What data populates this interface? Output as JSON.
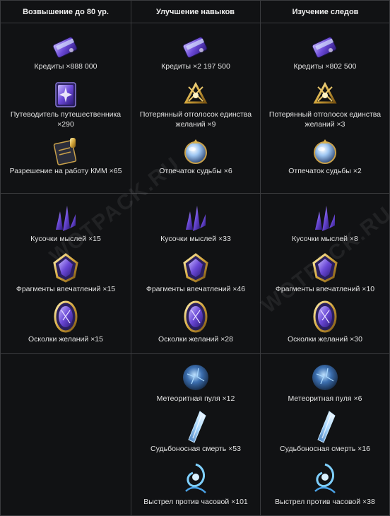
{
  "headers": [
    "Возвышение до 80 ур.",
    "Улучшение навыков",
    "Изучение следов"
  ],
  "watermark": "WOTPACK.RU",
  "row1": {
    "c1": [
      {
        "label": "Кредиты ×888 000",
        "icon": "credits-card-icon"
      },
      {
        "label": "Путеводитель путешественника ×290",
        "icon": "travelers-guide-book-icon"
      },
      {
        "label": "Разрешение на работу КММ ×65",
        "icon": "work-permit-icon"
      }
    ],
    "c2": [
      {
        "label": "Кредиты ×2 197 500",
        "icon": "credits-card-icon"
      },
      {
        "label": "Потерянный отголосок единства желаний ×9",
        "icon": "lost-echo-icon"
      },
      {
        "label": "Отпечаток судьбы ×6",
        "icon": "fate-imprint-orb-icon"
      }
    ],
    "c3": [
      {
        "label": "Кредиты ×802 500",
        "icon": "credits-card-icon"
      },
      {
        "label": "Потерянный отголосок единства желаний ×3",
        "icon": "lost-echo-icon"
      },
      {
        "label": "Отпечаток судьбы ×2",
        "icon": "fate-imprint-orb-icon"
      }
    ]
  },
  "row2": {
    "c1": [
      {
        "label": "Кусочки мыслей ×15",
        "icon": "thought-shards-icon"
      },
      {
        "label": "Фрагменты впечатлений ×15",
        "icon": "impression-fragment-icon"
      },
      {
        "label": "Осколки желаний ×15",
        "icon": "wish-shards-icon"
      }
    ],
    "c2": [
      {
        "label": "Кусочки мыслей ×33",
        "icon": "thought-shards-icon"
      },
      {
        "label": "Фрагменты впечатлений ×46",
        "icon": "impression-fragment-icon"
      },
      {
        "label": "Осколки желаний ×28",
        "icon": "wish-shards-icon"
      }
    ],
    "c3": [
      {
        "label": "Кусочки мыслей ×8",
        "icon": "thought-shards-icon"
      },
      {
        "label": "Фрагменты впечатлений ×10",
        "icon": "impression-fragment-icon"
      },
      {
        "label": "Осколки желаний ×30",
        "icon": "wish-shards-icon"
      }
    ]
  },
  "row3": {
    "c2": [
      {
        "label": "Метеоритная пуля ×12",
        "icon": "meteorite-bullet-icon"
      },
      {
        "label": "Судьбоносная смерть ×53",
        "icon": "fateful-death-icon"
      },
      {
        "label": "Выстрел против часовой ×101",
        "icon": "counterclockwise-shot-icon"
      }
    ],
    "c3": [
      {
        "label": "Метеоритная пуля ×6",
        "icon": "meteorite-bullet-icon"
      },
      {
        "label": "Судьбоносная смерть ×16",
        "icon": "fateful-death-icon"
      },
      {
        "label": "Выстрел против часовой ×38",
        "icon": "counterclockwise-shot-icon"
      }
    ]
  }
}
